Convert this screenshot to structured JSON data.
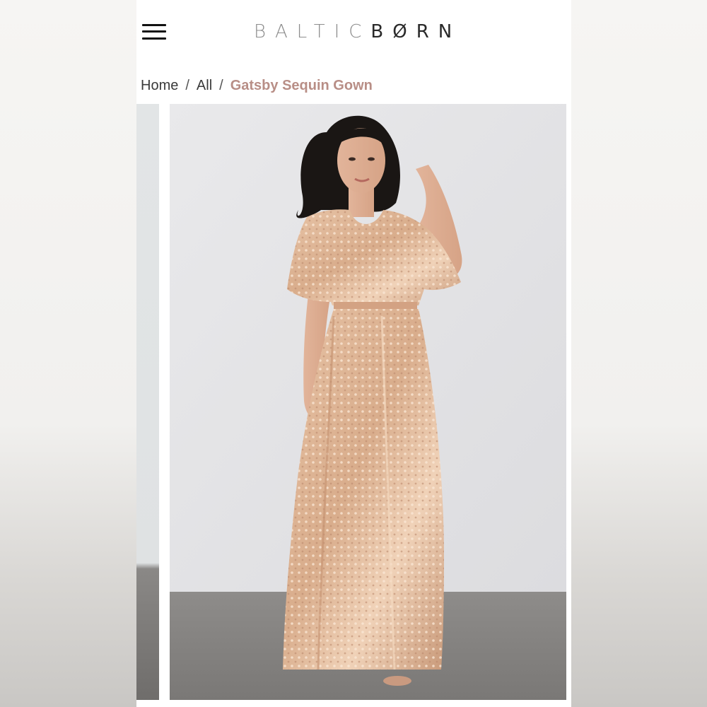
{
  "header": {
    "menu_icon": "hamburger-menu-icon",
    "logo_part1": "BALTIC",
    "logo_part2": "BØRN"
  },
  "breadcrumb": {
    "items": [
      "Home",
      "All"
    ],
    "separator": "/",
    "current": "Gatsby Sequin Gown"
  },
  "colors": {
    "breadcrumb_current": "#b88e86",
    "logo_light": "#8d8d8d",
    "logo_dark": "#2a2a2a"
  }
}
